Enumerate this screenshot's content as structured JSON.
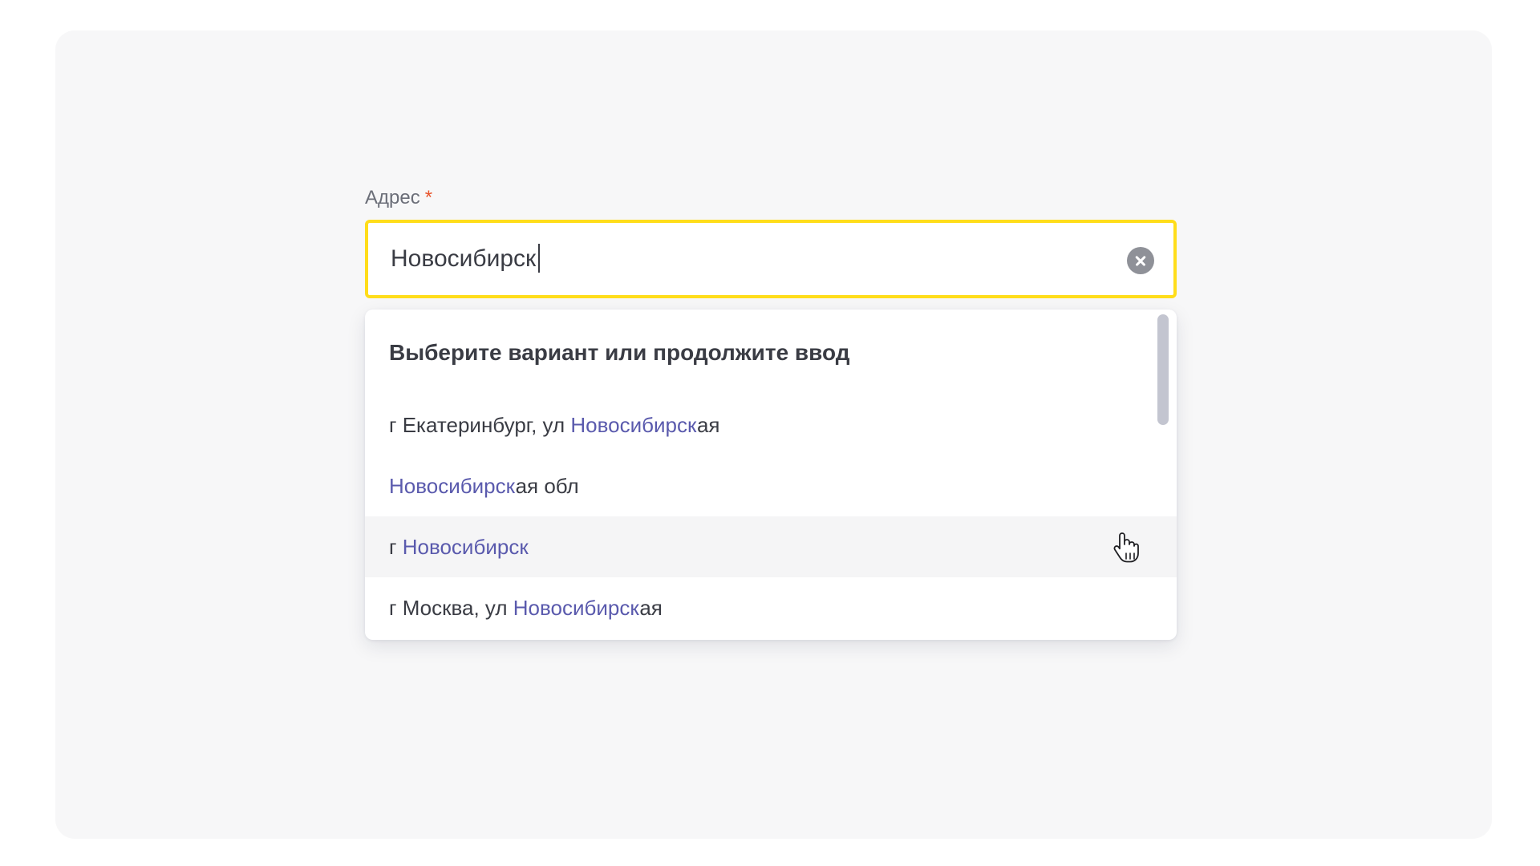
{
  "field": {
    "label": "Адрес",
    "required_mark": "*",
    "value": "Новосибирск"
  },
  "dropdown": {
    "heading": "Выберите вариант или продолжите ввод",
    "options": [
      {
        "prefix": "г Екатеринбург, ул ",
        "match": "Новосибирск",
        "suffix": "ая"
      },
      {
        "prefix": "",
        "match": "Новосибирск",
        "suffix": "ая обл"
      },
      {
        "prefix": "г ",
        "match": "Новосибирск",
        "suffix": ""
      },
      {
        "prefix": "г Москва, ул ",
        "match": "Новосибирск",
        "suffix": "ая"
      }
    ],
    "hovered_index": 2
  },
  "icons": {
    "clear": "clear-circle-x-icon",
    "cursor": "hand-pointer-icon"
  },
  "colors": {
    "focus_border": "#ffdd1a",
    "required": "#e8542c",
    "match_highlight": "#5a5aad",
    "hover_row": "#f5f5f6",
    "card_background": "#f7f7f8"
  }
}
